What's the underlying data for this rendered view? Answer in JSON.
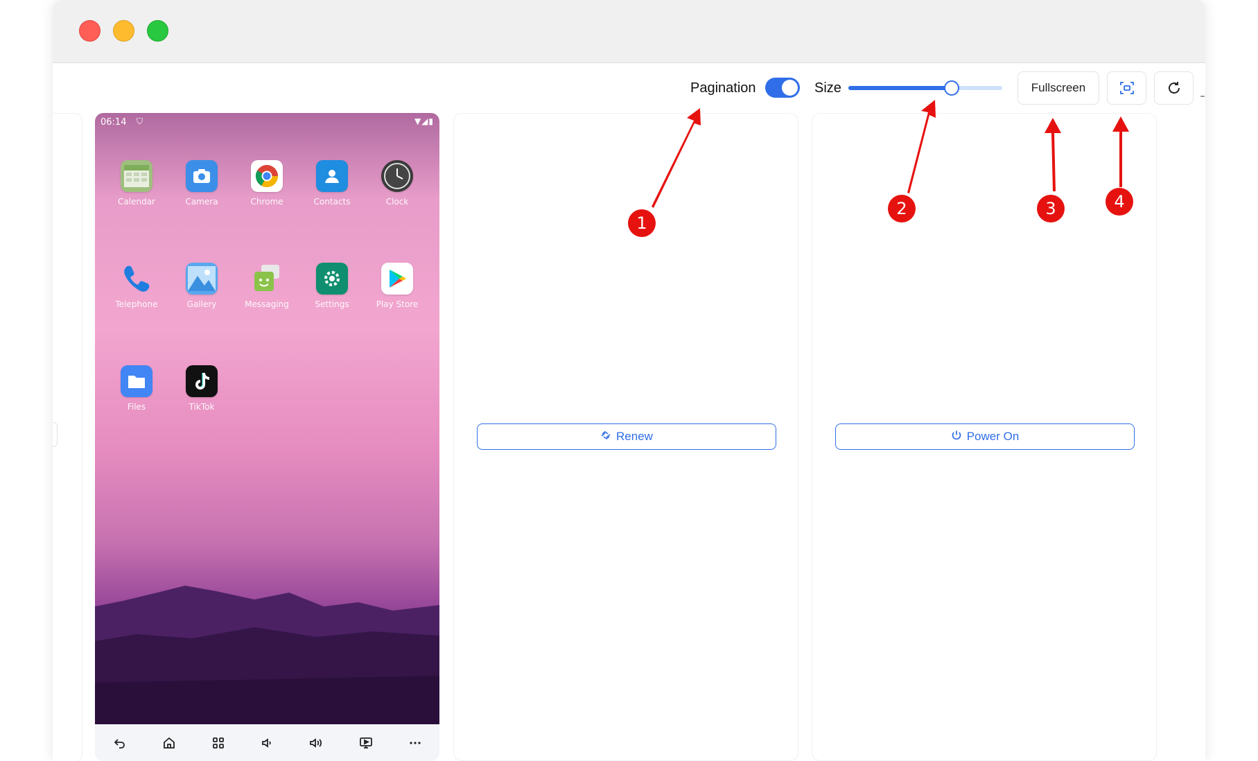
{
  "toolbar": {
    "pagination_label": "Pagination",
    "pagination_on": true,
    "size_label": "Size",
    "size_percent": 67,
    "fullscreen_label": "Fullscreen",
    "capture_icon": "capture-frame-icon",
    "refresh_icon": "refresh-icon"
  },
  "phone": {
    "status_time": "06:14",
    "apps": [
      {
        "label": "Calendar",
        "icon": "calendar-icon"
      },
      {
        "label": "Camera",
        "icon": "camera-icon"
      },
      {
        "label": "Chrome",
        "icon": "chrome-icon"
      },
      {
        "label": "Contacts",
        "icon": "contacts-icon"
      },
      {
        "label": "Clock",
        "icon": "clock-icon"
      },
      {
        "label": "Telephone",
        "icon": "phone-icon"
      },
      {
        "label": "Gallery",
        "icon": "gallery-icon"
      },
      {
        "label": "Messaging",
        "icon": "messaging-icon"
      },
      {
        "label": "Settings",
        "icon": "settings-icon"
      },
      {
        "label": "Play Store",
        "icon": "play-store-icon"
      },
      {
        "label": "Files",
        "icon": "files-icon"
      },
      {
        "label": "TikTok",
        "icon": "tiktok-icon"
      }
    ],
    "nav_icons": [
      "back-icon",
      "home-icon",
      "apps-grid-icon",
      "volume-down-icon",
      "volume-up-icon",
      "screen-cast-icon",
      "more-icon"
    ]
  },
  "cards": {
    "renew_label": "Renew",
    "power_on_label": "Power On"
  },
  "annotations": [
    "1",
    "2",
    "3",
    "4"
  ],
  "colors": {
    "accent": "#2f6ee8",
    "annotation": "#e6120f"
  }
}
